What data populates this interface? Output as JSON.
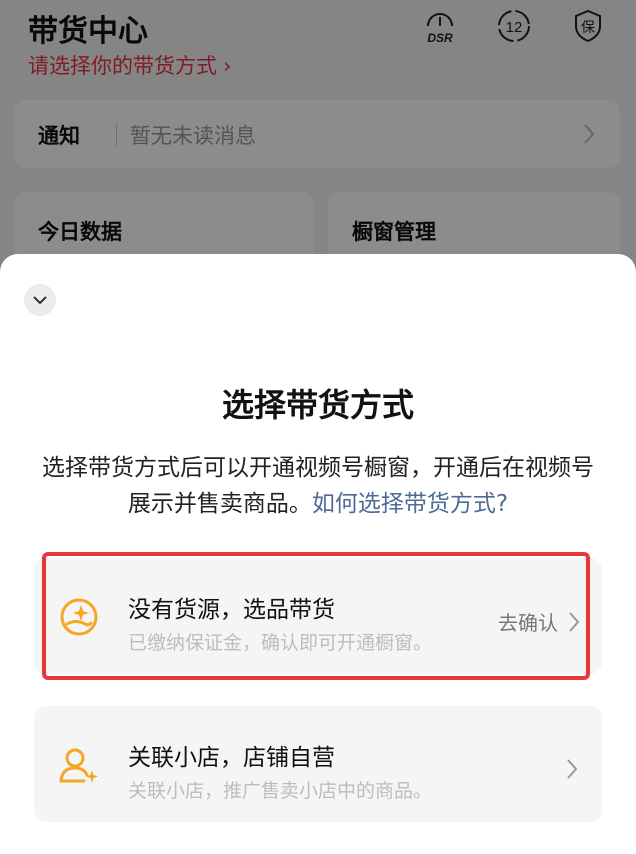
{
  "background": {
    "title": "带货中心",
    "subtitle": "请选择你的带货方式",
    "subtitle_chevron": "›",
    "icons": {
      "dsr": "DSR",
      "count": "12",
      "protect": "保"
    },
    "notice": {
      "label": "通知",
      "message": "暂无未读消息"
    },
    "cards": {
      "today": "今日数据",
      "showcase": "橱窗管理"
    }
  },
  "sheet": {
    "title": "选择带货方式",
    "description": "选择带货方式后可以开通视频号橱窗，开通后在视频号展示并售卖商品。",
    "help_link": "如何选择带货方式?",
    "options": [
      {
        "title": "没有货源，选品带货",
        "subtitle": "已缴纳保证金，确认即可开通橱窗。",
        "action": "去确认",
        "icon": "hand-sparkle-icon"
      },
      {
        "title": "关联小店，店铺自营",
        "subtitle": "关联小店，推广售卖小店中的商品。",
        "icon": "person-sparkle-icon"
      }
    ]
  },
  "colors": {
    "accent_red": "#e8324a",
    "highlight_border": "#e8373a",
    "icon_orange": "#f5a623",
    "link_blue": "#4f6a97"
  }
}
